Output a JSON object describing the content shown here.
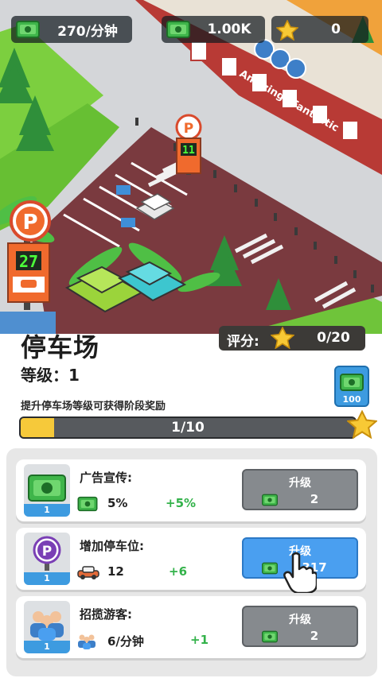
{
  "stats": {
    "income": "270/分钟",
    "cash": "1.00K",
    "stars": "0"
  },
  "scene": {
    "parking_sign_big_number": "27",
    "parking_sign_small_number": "11",
    "parking_sign_letter": "P",
    "building_sign": "Amazing&Fantastic"
  },
  "facility": {
    "title": "停车场",
    "level_label": "等级：1",
    "rating_label": "评分:",
    "rating_value": "0/20",
    "hint": "提升停车场等级可获得阶段奖励",
    "progress_text": "1/10",
    "progress_fraction": 0.1,
    "reward_amount": "100"
  },
  "upgrades": [
    {
      "name": "广告宣传:",
      "level": "1",
      "stat_value": "5%",
      "stat_increase": "+5%",
      "button_label": "升级",
      "cost": "2",
      "icon": "cash-icon",
      "stat_icon": "cash-icon",
      "active": false
    },
    {
      "name": "增加停车位:",
      "level": "1",
      "stat_value": "12",
      "stat_increase": "+6",
      "button_label": "升级",
      "cost": "317",
      "icon": "parking-pin-icon",
      "stat_icon": "car-icon",
      "active": true
    },
    {
      "name": "招揽游客:",
      "level": "1",
      "stat_value": "6/分钟",
      "stat_increase": "+1",
      "button_label": "升级",
      "cost": "2",
      "icon": "visitors-icon",
      "stat_icon": "visitors-icon",
      "active": false
    }
  ],
  "colors": {
    "accent_blue": "#4a9ff0",
    "positive_green": "#33b24a",
    "progress_yellow": "#f6c93a",
    "button_gray": "#868a8e"
  }
}
